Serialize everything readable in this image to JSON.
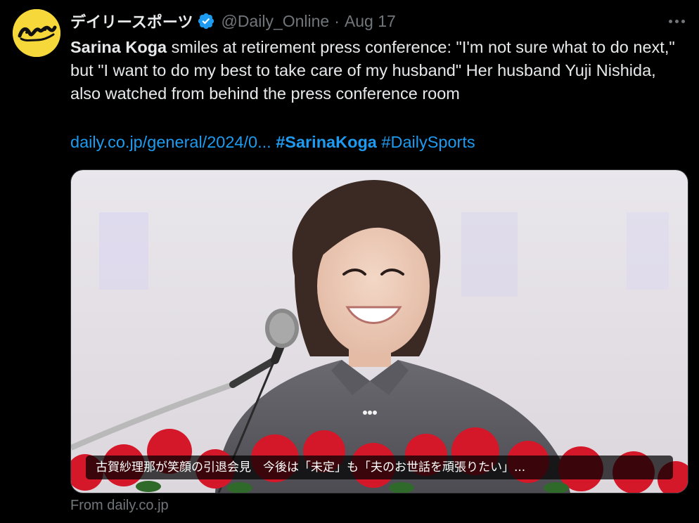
{
  "tweet": {
    "display_name": "デイリースポーツ",
    "handle": "@Daily_Online",
    "separator": "·",
    "date": "Aug 17",
    "body_bold": "Sarina Koga",
    "body_rest": " smiles at retirement press conference: \"I'm not sure what to do next,\" but \"I want to do my best to take care of my husband\" Her husband Yuji Nishida, also watched from behind the press conference room",
    "link": "daily.co.jp/general/2024/0...",
    "hashtag1": "#SarinaKoga",
    "hashtag2": "#DailySports",
    "card_caption": "古賀紗理那が笑顔の引退会見　今後は「未定」も「夫のお世話を頑張りたい」...",
    "card_source": "From daily.co.jp"
  },
  "icons": {
    "verified": "verified-badge-icon",
    "more": "more-options-icon",
    "avatar": "daily-sports-logo"
  },
  "colors": {
    "background": "#000000",
    "text": "#e7e9ea",
    "muted": "#71767b",
    "link": "#1d9bf0",
    "avatar_bg": "#f6d83a"
  }
}
